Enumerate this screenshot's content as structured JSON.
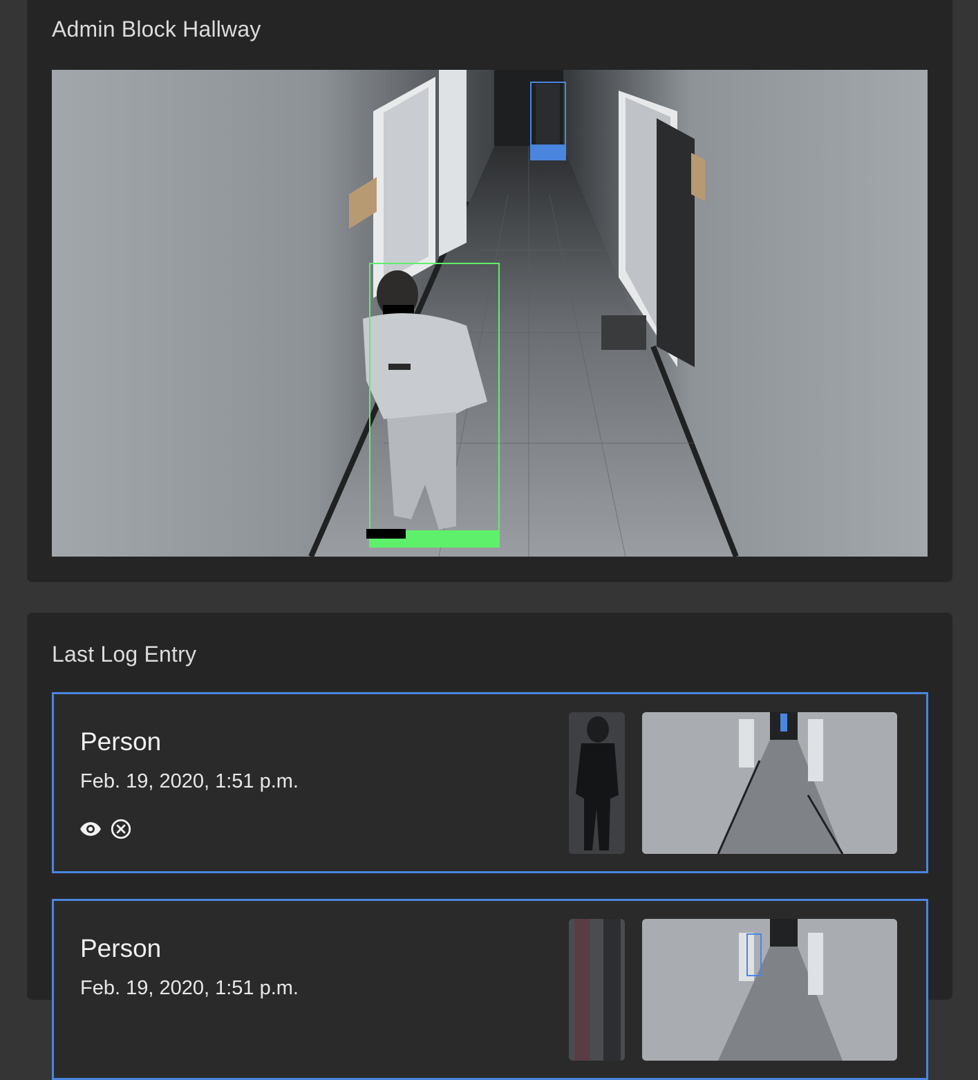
{
  "camera": {
    "title": "Admin Block Hallway"
  },
  "log": {
    "title": "Last Log Entry",
    "entries": [
      {
        "type": "Person",
        "time": "Feb. 19, 2020, 1:51 p.m."
      },
      {
        "type": "Person",
        "time": "Feb. 19, 2020, 1:51 p.m."
      }
    ]
  },
  "icons": {
    "view": "eye-icon",
    "dismiss": "close-circle-icon"
  },
  "colors": {
    "page_bg": "#353535",
    "panel_bg": "#252525",
    "card_border": "#4a86e0",
    "detection_near": "#5ef06a",
    "detection_far": "#4a86e0"
  }
}
